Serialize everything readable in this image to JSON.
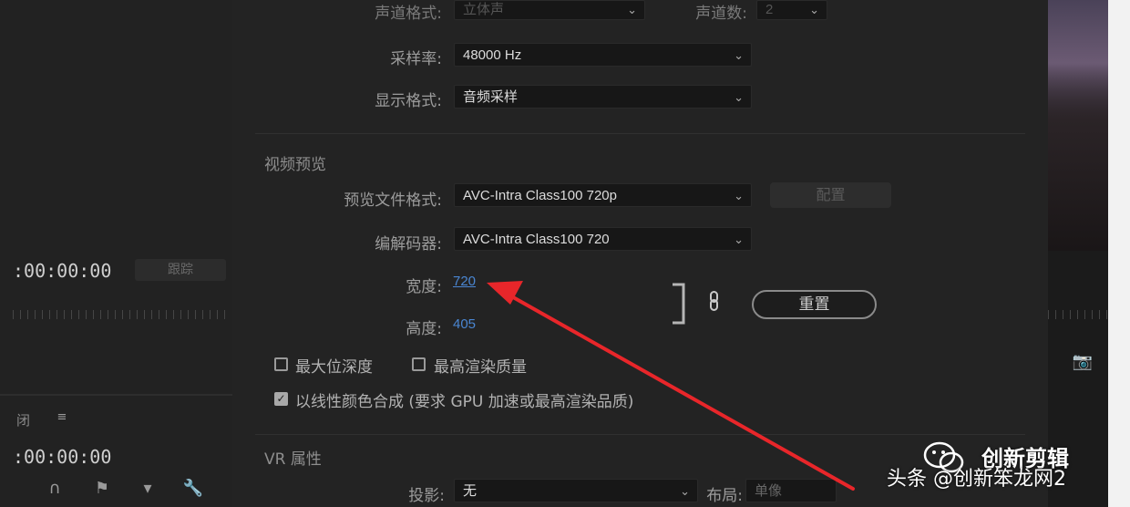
{
  "left": {
    "timecode_top": ":00:00:00",
    "timecode_bottom": ":00:00:00",
    "blur_button": "跟踪",
    "bottom_tab": "闭",
    "bottom_icons": [
      "loop-icon",
      "marker-icon",
      "marker-icon",
      "wrench-icon"
    ]
  },
  "audio": {
    "channel_format_label": "声道格式:",
    "channel_format_value": "立体声",
    "channel_count_label": "声道数:",
    "channel_count_value": "2",
    "sample_rate_label": "采样率:",
    "sample_rate_value": "48000 Hz",
    "display_format_label": "显示格式:",
    "display_format_value": "音频采样"
  },
  "video_preview": {
    "title": "视频预览",
    "file_format_label": "预览文件格式:",
    "file_format_value": "AVC-Intra Class100 720p",
    "configure_button": "配置",
    "codec_label": "编解码器:",
    "codec_value": "AVC-Intra Class100 720",
    "width_label": "宽度:",
    "width_value": "720",
    "height_label": "高度:",
    "height_value": "405",
    "reset_button": "重置",
    "max_bit_depth_label": "最大位深度",
    "max_bit_depth_checked": false,
    "max_render_quality_label": "最高渲染质量",
    "max_render_quality_checked": false,
    "linear_color_label": "以线性颜色合成 (要求 GPU 加速或最高渲染品质)",
    "linear_color_checked": true
  },
  "vr": {
    "title": "VR 属性",
    "projection_label": "投影:",
    "projection_value": "无",
    "layout_label": "布局:",
    "layout_value": "单像"
  },
  "watermark": {
    "brand": "创新剪辑",
    "byline": "头条 @创新笨龙网2"
  },
  "colors": {
    "link": "#4a86d2",
    "arrow": "#e8262a",
    "background": "#232323"
  }
}
